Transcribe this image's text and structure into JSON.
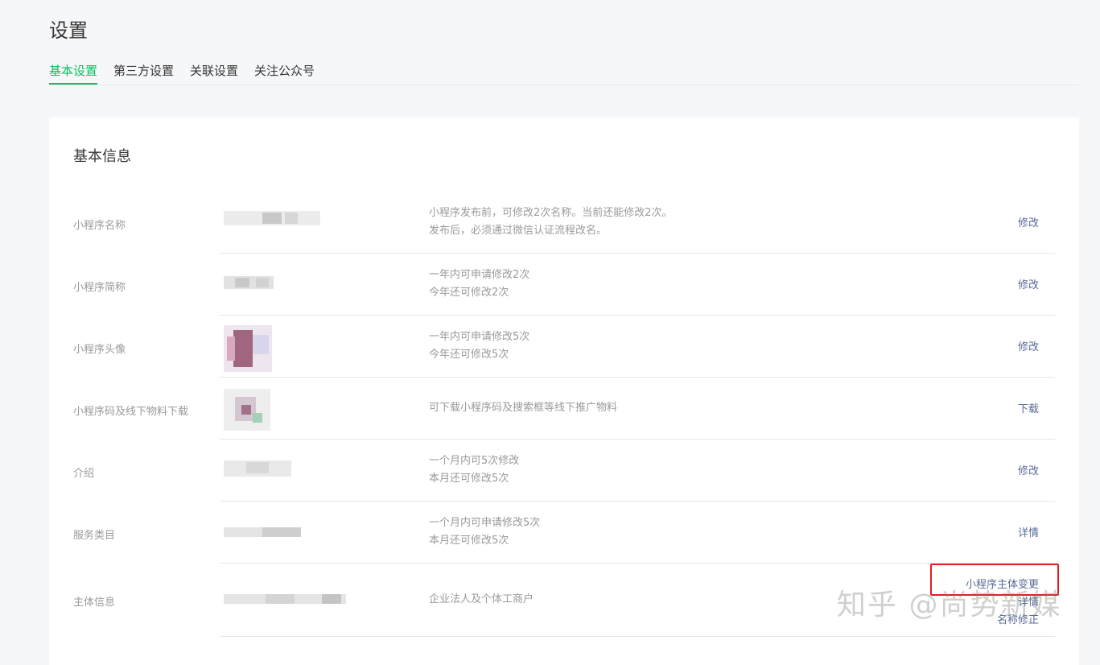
{
  "page": {
    "title": "设置"
  },
  "tabs": [
    {
      "label": "基本设置",
      "active": true
    },
    {
      "label": "第三方设置",
      "active": false
    },
    {
      "label": "关联设置",
      "active": false
    },
    {
      "label": "关注公众号",
      "active": false
    }
  ],
  "section": {
    "title": "基本信息"
  },
  "rows": [
    {
      "label": "小程序名称",
      "desc": [
        "小程序发布前，可修改2次名称。当前还能修改2次。",
        "发布后，必须通过微信认证流程改名。"
      ],
      "actions": [
        "修改"
      ]
    },
    {
      "label": "小程序简称",
      "desc": [
        "一年内可申请修改2次",
        "今年还可修改2次"
      ],
      "actions": [
        "修改"
      ]
    },
    {
      "label": "小程序头像",
      "desc": [
        "一年内可申请修改5次",
        "今年还可修改5次"
      ],
      "actions": [
        "修改"
      ]
    },
    {
      "label": "小程序码及线下物料下载",
      "desc": [
        "可下载小程序码及搜索框等线下推广物料"
      ],
      "actions": [
        "下载"
      ]
    },
    {
      "label": "介绍",
      "desc": [
        "一个月内可5次修改",
        "本月还可修改5次"
      ],
      "actions": [
        "修改"
      ]
    },
    {
      "label": "服务类目",
      "desc": [
        "一个月内可申请修改5次",
        "本月还可修改5次"
      ],
      "actions": [
        "详情"
      ]
    },
    {
      "label": "主体信息",
      "desc": [
        "企业法人及个体工商户"
      ],
      "actions": [
        "小程序主体变更",
        "详情",
        "名称修正"
      ]
    }
  ],
  "watermark": "知乎 @尚势新媒",
  "colors": {
    "accent": "#07c160",
    "link": "#576b95",
    "highlight_box": "#e02020"
  }
}
